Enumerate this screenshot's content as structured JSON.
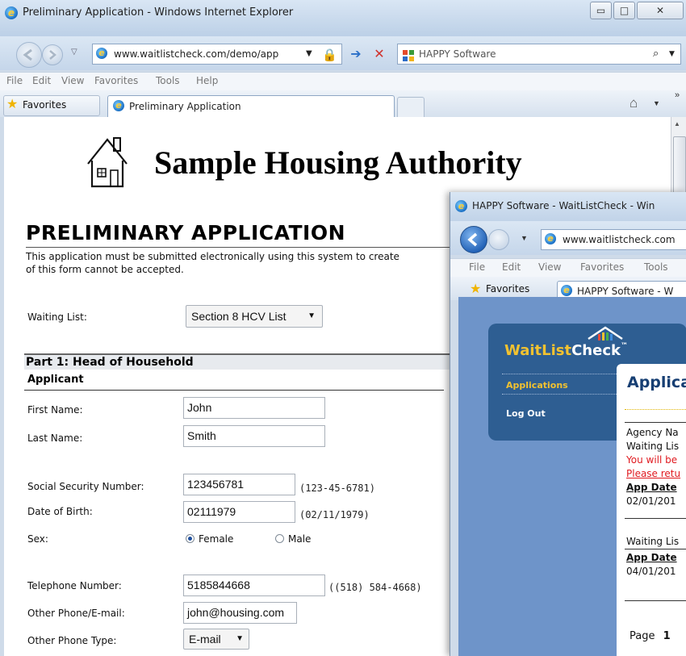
{
  "window1": {
    "title": "Preliminary Application - Windows Internet Explorer",
    "controls": {
      "minimize": "▭",
      "maximize": "□",
      "close": "✕"
    },
    "address": "www.waitlistcheck.com/demo/app",
    "search_provider": "HAPPY Software",
    "menu": [
      "File",
      "Edit",
      "View",
      "Favorites",
      "Tools",
      "Help"
    ],
    "favorites_label": "Favorites",
    "tab_label": "Preliminary Application",
    "more_chevron": "»"
  },
  "page": {
    "org_title": "Sample Housing Authority",
    "heading": "PRELIMINARY APPLICATION",
    "intro_line1": "This application must be submitted electronically using this system to create",
    "intro_line2": "of this form cannot be accepted.",
    "waiting_list_label": "Waiting List:",
    "waiting_list_value": "Section 8 HCV List",
    "part1_title": "Part 1: Head of Household",
    "applicant_title": "Applicant",
    "first_name_label": "First Name:",
    "first_name_value": "John",
    "last_name_label": "Last Name:",
    "last_name_value": "Smith",
    "ssn_label": "Social Security Number:",
    "ssn_value": "123456781",
    "ssn_hint": "(123-45-6781)",
    "dob_label": "Date of Birth:",
    "dob_value": "02111979",
    "dob_hint": "(02/11/1979)",
    "sex_label": "Sex:",
    "sex_female": "Female",
    "sex_male": "Male",
    "sex_selected": "Female",
    "phone_label": "Telephone Number:",
    "phone_value": "5185844668",
    "phone_hint": "((518) 584-4668)",
    "other_phone_label": "Other Phone/E-mail:",
    "other_phone_value": "john@housing.com",
    "other_type_label": "Other Phone Type:",
    "other_type_value": "E-mail"
  },
  "window2": {
    "title": "HAPPY Software - WaitListCheck - Win",
    "address": "www.waitlistcheck.com",
    "menu": [
      "File",
      "Edit",
      "View",
      "Favorites",
      "Tools"
    ],
    "favorites_label": "Favorites",
    "tab_label": "HAPPY Software - W",
    "logo_text_1": "WaitList",
    "logo_text_2": "Check",
    "logo_tm": "™",
    "nav_applications": "Applications",
    "nav_logout": "Log Out",
    "card_heading": "Applica",
    "card_lines": {
      "agency": "Agency Na",
      "waiting": "Waiting Lis",
      "red1": "You will be",
      "red2": "Please retu",
      "app_date_1": "App Date",
      "date_1": "02/01/201",
      "waiting_2": "Waiting Lis",
      "app_date_2": "App Date",
      "date_2": "04/01/201",
      "page_label": "Page",
      "page_num": "1"
    }
  }
}
